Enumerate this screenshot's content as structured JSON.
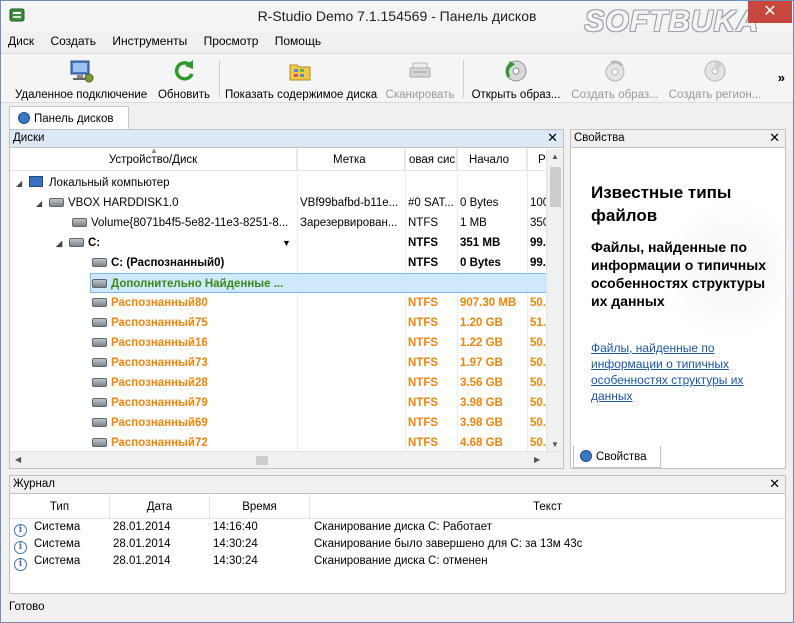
{
  "window": {
    "title": "R-Studio Demo 7.1.154569 - Панель дисков",
    "watermark": "SOFTBUKA",
    "close": "✕"
  },
  "menu": [
    "Диск",
    "Создать",
    "Инструменты",
    "Просмотр",
    "Помощь"
  ],
  "toolbar": {
    "remote": "Удаленное подключение",
    "refresh": "Обновить",
    "show": "Показать содержимое диска",
    "scan": "Сканировать",
    "open_image": "Открыть образ...",
    "create_image": "Создать образ...",
    "create_region": "Создать регион...",
    "more": "»"
  },
  "tabs": {
    "disks_panel": "Панель дисков"
  },
  "disks": {
    "header": "Диски",
    "close": "✕",
    "columns": [
      "Устройство/Диск",
      "Метка",
      "овая сис",
      "Начало",
      "Р"
    ],
    "rows": [
      {
        "name": "Локальный компьютер",
        "label": "",
        "fs": "",
        "start": "",
        "size": ""
      },
      {
        "name": "VBOX HARDDISK1.0",
        "label": "VBf99bafbd-b11e...",
        "fs": "#0 SAT...",
        "start": "0 Bytes",
        "size": "100"
      },
      {
        "name": "Volume{8071b4f5-5e82-11e3-8251-8...",
        "label": "Зарезервирован...",
        "fs": "NTFS",
        "start": "1 MB",
        "size": "350"
      },
      {
        "name": "C:",
        "label": "",
        "fs": "NTFS",
        "start": "351 MB",
        "size": "99."
      },
      {
        "name": "C: (Распознанный0)",
        "label": "",
        "fs": "NTFS",
        "start": "0 Bytes",
        "size": "99."
      },
      {
        "name": "Дополнительно Найденные ...",
        "label": "",
        "fs": "",
        "start": "",
        "size": ""
      },
      {
        "name": "Распознанный80",
        "label": "",
        "fs": "NTFS",
        "start": "907.30 MB",
        "size": "50."
      },
      {
        "name": "Распознанный75",
        "label": "",
        "fs": "NTFS",
        "start": "1.20 GB",
        "size": "51."
      },
      {
        "name": "Распознанный16",
        "label": "",
        "fs": "NTFS",
        "start": "1.22 GB",
        "size": "50."
      },
      {
        "name": "Распознанный73",
        "label": "",
        "fs": "NTFS",
        "start": "1.97 GB",
        "size": "50."
      },
      {
        "name": "Распознанный28",
        "label": "",
        "fs": "NTFS",
        "start": "3.56 GB",
        "size": "50."
      },
      {
        "name": "Распознанный79",
        "label": "",
        "fs": "NTFS",
        "start": "3.98 GB",
        "size": "50."
      },
      {
        "name": "Распознанный69",
        "label": "",
        "fs": "NTFS",
        "start": "3.98 GB",
        "size": "50."
      },
      {
        "name": "Распознанный72",
        "label": "",
        "fs": "NTFS",
        "start": "4.68 GB",
        "size": "50."
      }
    ]
  },
  "properties": {
    "header": "Свойства",
    "close": "✕",
    "title": "Известные типы файлов",
    "subtitle": "Файлы, найденные по информации о типичных особенностях структуры их данных",
    "link": "Файлы, найденные по информации о типичных особенностях структуры их данных",
    "tab": "Свойства"
  },
  "journal": {
    "header": "Журнал",
    "close": "✕",
    "columns": [
      "Тип",
      "Дата",
      "Время",
      "Текст"
    ],
    "rows": [
      {
        "type": "Система",
        "date": "28.01.2014",
        "time": "14:16:40",
        "text": "Сканирование диска C: Работает"
      },
      {
        "type": "Система",
        "date": "28.01.2014",
        "time": "14:30:24",
        "text": "Сканирование было завершено для C: за 13м 43с"
      },
      {
        "type": "Система",
        "date": "28.01.2014",
        "time": "14:30:24",
        "text": "Сканирование диска C: отменен"
      }
    ]
  },
  "status": "Готово",
  "colors": {
    "found_text": "#f0840c",
    "selection": "#cfe8fb",
    "link": "#1a55a8",
    "close_button": "#c7463d"
  }
}
